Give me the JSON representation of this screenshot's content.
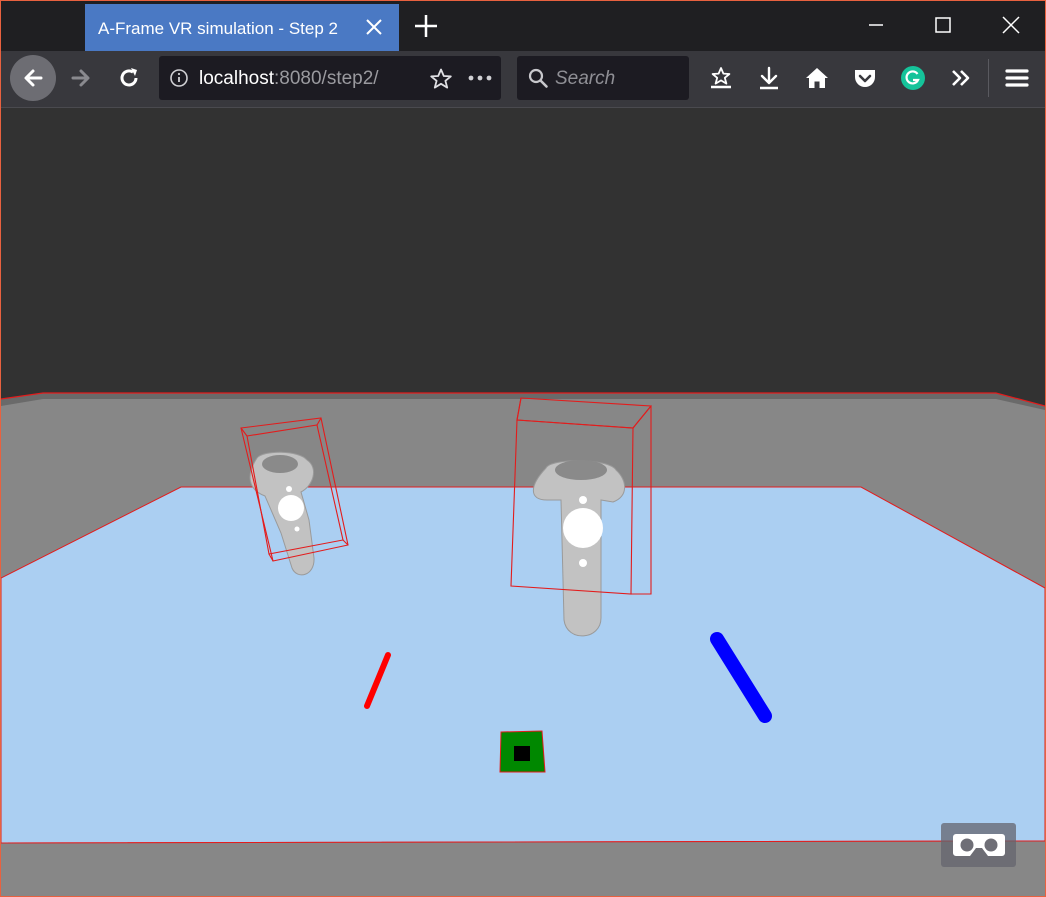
{
  "browser": {
    "tab": {
      "title": "A-Frame VR simulation - Step 2"
    },
    "address": {
      "host": "localhost",
      "rest": ":8080/step2/"
    },
    "search": {
      "placeholder": "Search"
    }
  },
  "icons": {
    "tab_close": "close-icon",
    "new_tab": "plus-icon",
    "back": "arrow-left-icon",
    "forward": "arrow-right-icon",
    "reload": "reload-icon",
    "info": "info-icon",
    "bookmark": "star-icon",
    "page_actions": "more-horizontal-icon",
    "library": "library-icon",
    "downloads": "download-icon",
    "home": "home-icon",
    "pocket": "pocket-icon",
    "grammarly": "grammarly-icon",
    "overflow": "chevron-double-right-icon",
    "menu": "hamburger-menu-icon",
    "vr": "vr-headset-icon"
  },
  "colors": {
    "tab_active": "#4a79c4",
    "floor": "#abcff2",
    "wall": "#858585",
    "sky": "#323232",
    "bounding_box": "#e31c1c",
    "red_pointer": "#ff0000",
    "blue_pointer": "#0000ff",
    "target_pad": "#008800"
  }
}
